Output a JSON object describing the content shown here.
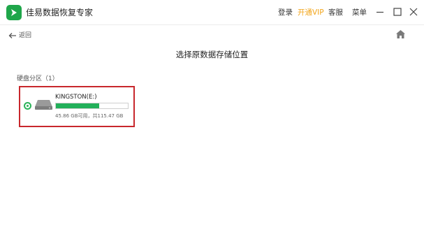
{
  "app": {
    "title": "佳易数据恢复专家",
    "logo_icon": "app-logo-icon",
    "brand_color": "#1fa64a"
  },
  "header": {
    "login_label": "登录",
    "vip_label": "开通VIP",
    "vip_color": "#f2a51a",
    "service_label": "客服",
    "menu_label": "菜单"
  },
  "window_controls": [
    "minimize-icon",
    "maximize-icon",
    "close-icon"
  ],
  "nav": {
    "back_label": "返回",
    "back_icon": "arrow-left-icon",
    "home_icon": "home-icon"
  },
  "page": {
    "heading": "选择原数据存储位置"
  },
  "disks": {
    "section_label": "硬盘分区（1）",
    "items": [
      {
        "name": "KINGSTON(E:)",
        "stats": "45.86 GB可用，共115.47 GB",
        "used_fraction": 0.6,
        "usage_color": "#22b05a",
        "selected": true,
        "icon": "hard-drive-icon"
      }
    ],
    "highlight_color": "#c8272c"
  }
}
